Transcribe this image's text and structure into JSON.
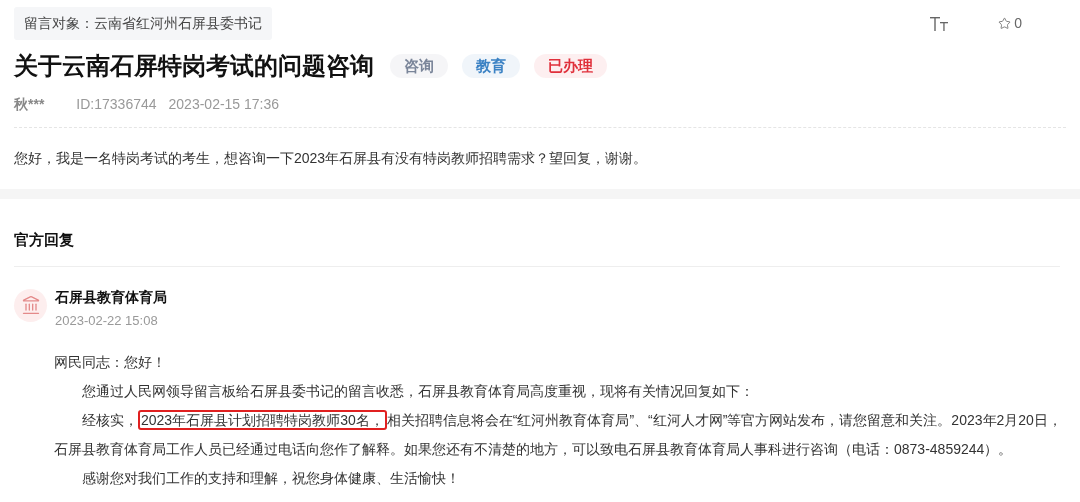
{
  "message": {
    "target": "留言对象：云南省红河州石屏县委书记",
    "title": "关于云南石屏特岗考试的问题咨询",
    "tags": [
      {
        "label": "咨询",
        "color": "#7a8599"
      },
      {
        "label": "教育",
        "color": "#3b82c4"
      },
      {
        "label": "已办理",
        "color": "#e0303b"
      }
    ],
    "author": "秋***",
    "id": "ID:17336744",
    "time": "2023-02-15 17:36",
    "star_count": "0",
    "body": "您好，我是一名特岗考试的考生，想咨询一下2023年石屏县有没有特岗教师招聘需求？望回复，谢谢。"
  },
  "reply": {
    "heading": "官方回复",
    "org": "石屏县教育体育局",
    "time": "2023-02-22 15:08",
    "greeting": "网民同志：您好！",
    "paragraphs": [
      {
        "before": "您通过人民网领导留言板给石屏县委书记的留言收悉，石屏县教育体育局高度重视，现将有关情况回复如下："
      },
      {
        "before": "经核实，",
        "highlight": "2023年石屏县计划招聘特岗教师30名，",
        "after": "相关招聘信息将会在“红河州教育体育局”、“红河人才网”等官方网站发布，请您留意和关注。2023年2月20日，石屏县教育体育局工作人员已经通过电话向您作了解释。如果您还有不清楚的地方，可以致电石屏县教育体育局人事科进行咨询（电话：0873-4859244）。"
      },
      {
        "before": "感谢您对我们工作的支持和理解，祝您身体健康、生活愉快！"
      }
    ]
  }
}
